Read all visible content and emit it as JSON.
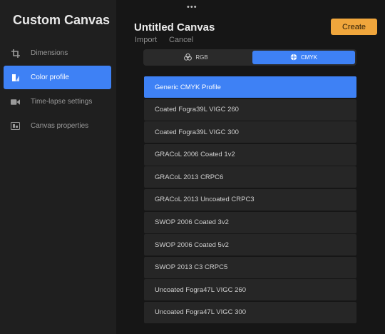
{
  "sidebar": {
    "title": "Custom Canvas",
    "items": [
      {
        "label": "Dimensions",
        "icon": "crop-icon"
      },
      {
        "label": "Color profile",
        "icon": "color-profile-icon",
        "active": true
      },
      {
        "label": "Time-lapse settings",
        "icon": "video-camera-icon"
      },
      {
        "label": "Canvas properties",
        "icon": "canvas-properties-icon"
      }
    ]
  },
  "header": {
    "title": "Untitled Canvas",
    "import_label": "Import",
    "cancel_label": "Cancel",
    "create_label": "Create",
    "more_label": "•••"
  },
  "mode_tabs": [
    {
      "label": "RGB",
      "icon": "rgb-circles-icon",
      "active": false
    },
    {
      "label": "CMYK",
      "icon": "globe-icon",
      "active": true
    }
  ],
  "profiles": [
    "Generic CMYK Profile",
    "Coated Fogra39L VIGC 260",
    "Coated Fogra39L VIGC 300",
    "GRACoL 2006 Coated 1v2",
    "GRACoL 2013 CRPC6",
    "GRACoL 2013 Uncoated CRPC3",
    "SWOP 2006 Coated 3v2",
    "SWOP 2006 Coated 5v2",
    "SWOP 2013 C3 CRPC5",
    "Uncoated Fogra47L VIGC 260",
    "Uncoated Fogra47L VIGC 300"
  ],
  "selected_profile_index": 0,
  "colors": {
    "accent": "#3e81f5",
    "create_button": "#f0a63c"
  }
}
